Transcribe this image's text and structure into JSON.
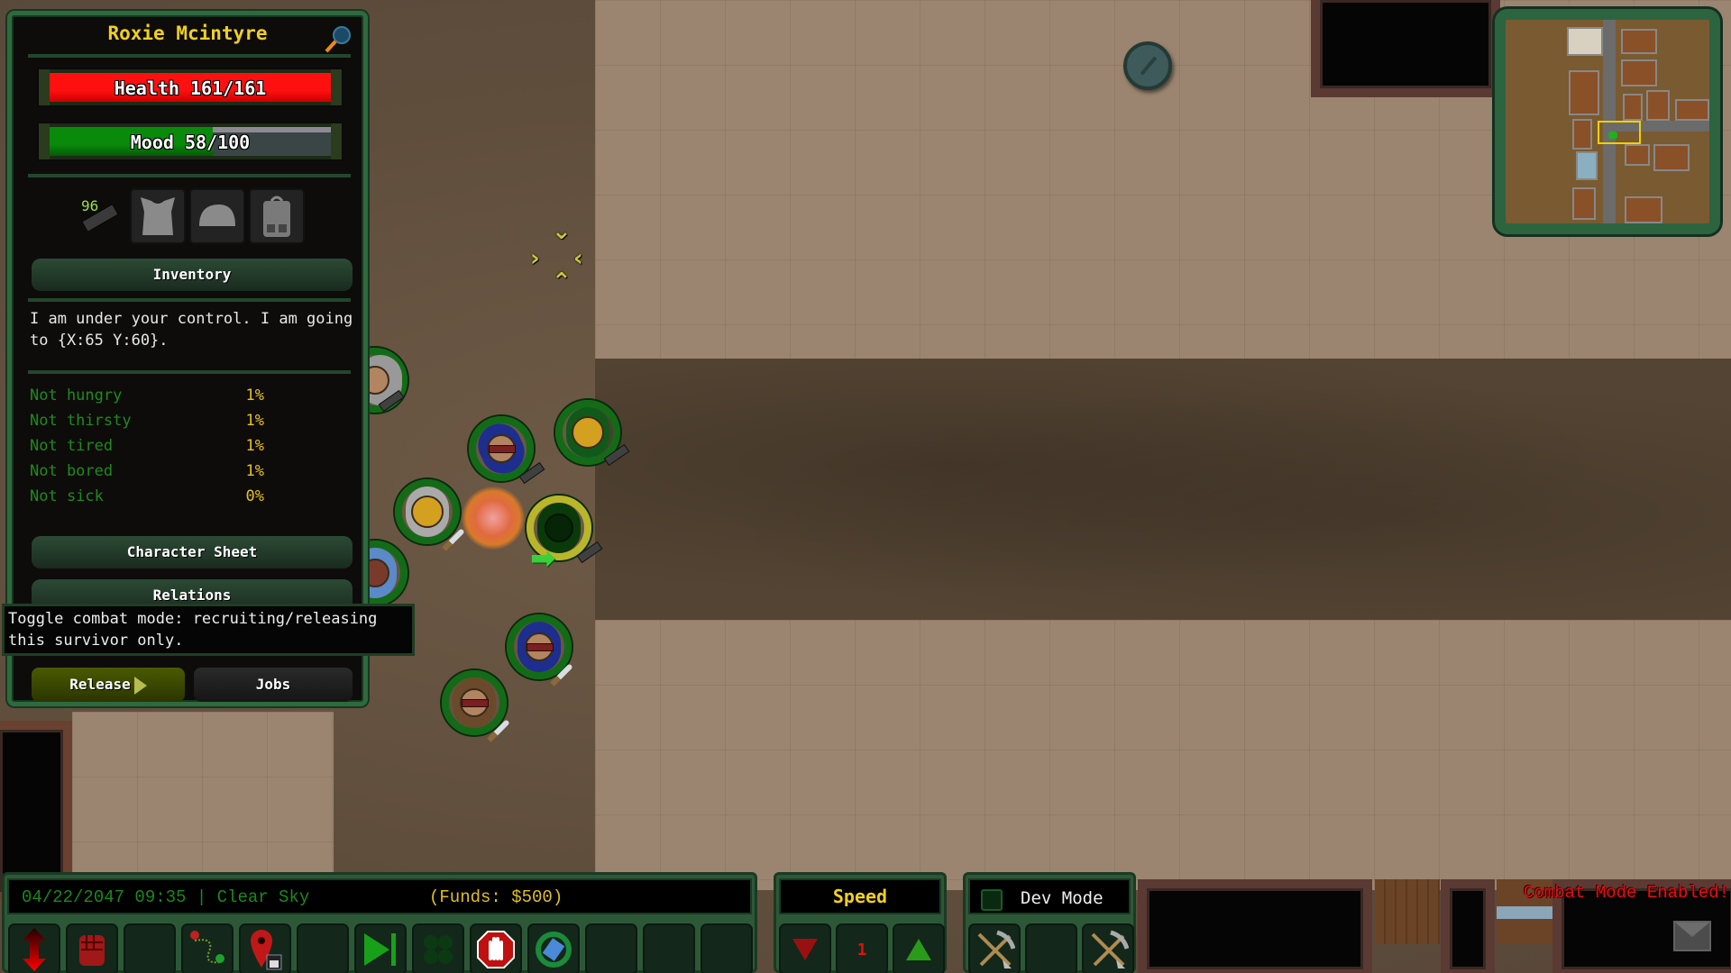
{
  "character": {
    "name": "Roxie Mcintyre",
    "health_label": "Health 161/161",
    "health": {
      "current": 161,
      "max": 161
    },
    "mood_label": "Mood 58/100",
    "mood": {
      "current": 58,
      "max": 100
    },
    "ammo_count": "96",
    "equipment_slots": [
      "weapon-pistol",
      "armor-vest",
      "helmet",
      "backpack"
    ],
    "inventory_button": "Inventory",
    "status_message": "I am under your control. I am going to {X:65 Y:60}.",
    "needs": [
      {
        "label": "Not hungry",
        "value": "1%"
      },
      {
        "label": "Not thirsty",
        "value": "1%"
      },
      {
        "label": "Not tired",
        "value": "1%"
      },
      {
        "label": "Not bored",
        "value": "1%"
      },
      {
        "label": "Not sick",
        "value": "0%"
      }
    ],
    "character_sheet_button": "Character Sheet",
    "relations_button": "Relations",
    "release_button": "Release",
    "jobs_button": "Jobs",
    "tooltip": "Toggle combat mode: recruiting/releasing this survivor only."
  },
  "status_bar": {
    "datetime_weather": "04/22/2047 09:35 | Clear Sky",
    "funds": "(Funds: $500)"
  },
  "toolbar": {
    "buttons": [
      {
        "icon": "up-down-arrow-icon"
      },
      {
        "icon": "fist-icon"
      },
      {
        "icon": "empty"
      },
      {
        "icon": "route-icon"
      },
      {
        "icon": "save-location-icon"
      },
      {
        "icon": "empty"
      },
      {
        "icon": "play-next-icon"
      },
      {
        "icon": "formation-icon"
      },
      {
        "icon": "stop-hand-icon"
      },
      {
        "icon": "rotate-icon"
      },
      {
        "icon": "empty"
      },
      {
        "icon": "empty"
      },
      {
        "icon": "empty"
      }
    ]
  },
  "speed": {
    "title": "Speed",
    "value": "1"
  },
  "dev_mode": {
    "label": "Dev Mode",
    "checked": false
  },
  "notifications": {
    "combat_mode": "Combat Mode Enabled!"
  },
  "colors": {
    "health": "#ff0000",
    "mood": "#0a8a0a",
    "accent_yellow": "#f0d020",
    "panel_green": "#2f6a3e",
    "combat_red": "#e01010"
  }
}
